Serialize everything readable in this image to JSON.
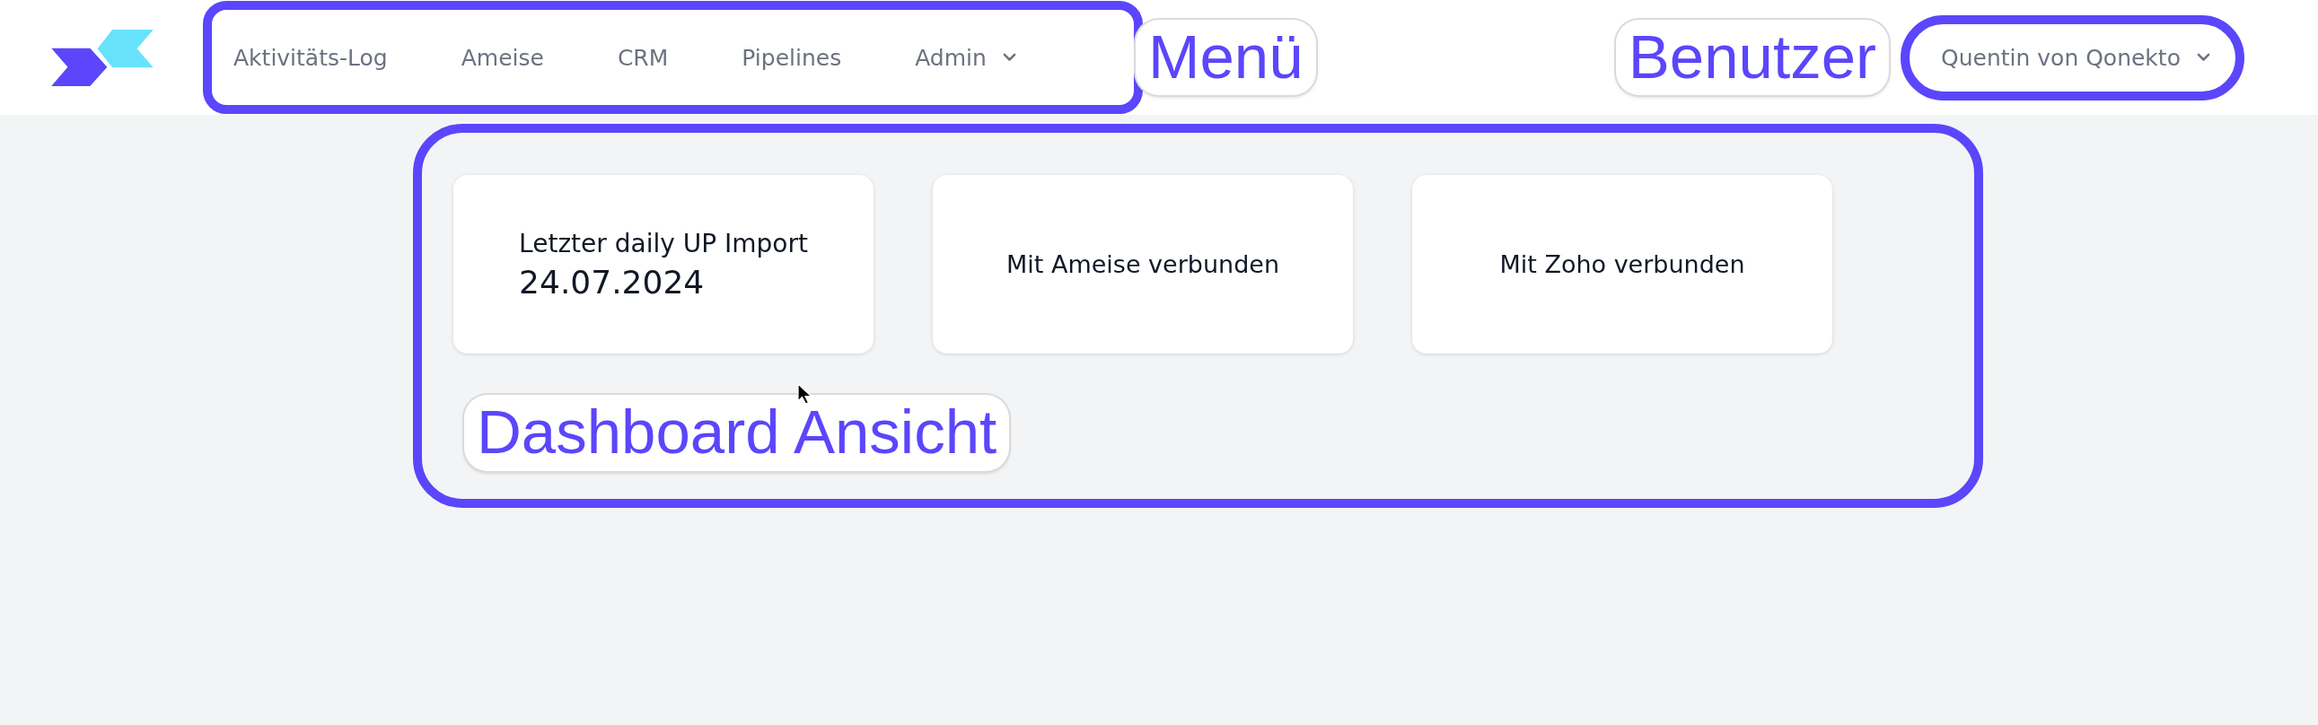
{
  "header": {
    "nav": {
      "annotation": "Menü",
      "items": [
        {
          "kind": "link",
          "label": "Aktivitäts-Log"
        },
        {
          "kind": "link",
          "label": "Ameise"
        },
        {
          "kind": "link",
          "label": "CRM"
        },
        {
          "kind": "link",
          "label": "Pipelines"
        },
        {
          "kind": "dropdown",
          "label": "Admin"
        }
      ]
    },
    "user_menu": {
      "annotation": "Benutzer",
      "label": "Quentin von Qonekto"
    }
  },
  "dashboard": {
    "annotation": "Dashboard Ansicht",
    "cards": [
      {
        "kind": "stat",
        "title": "Letzter daily UP Import",
        "value": "24.07.2024"
      },
      {
        "kind": "status",
        "title": "Mit Ameise verbunden"
      },
      {
        "kind": "status",
        "title": "Mit Zoho verbunden"
      }
    ]
  }
}
